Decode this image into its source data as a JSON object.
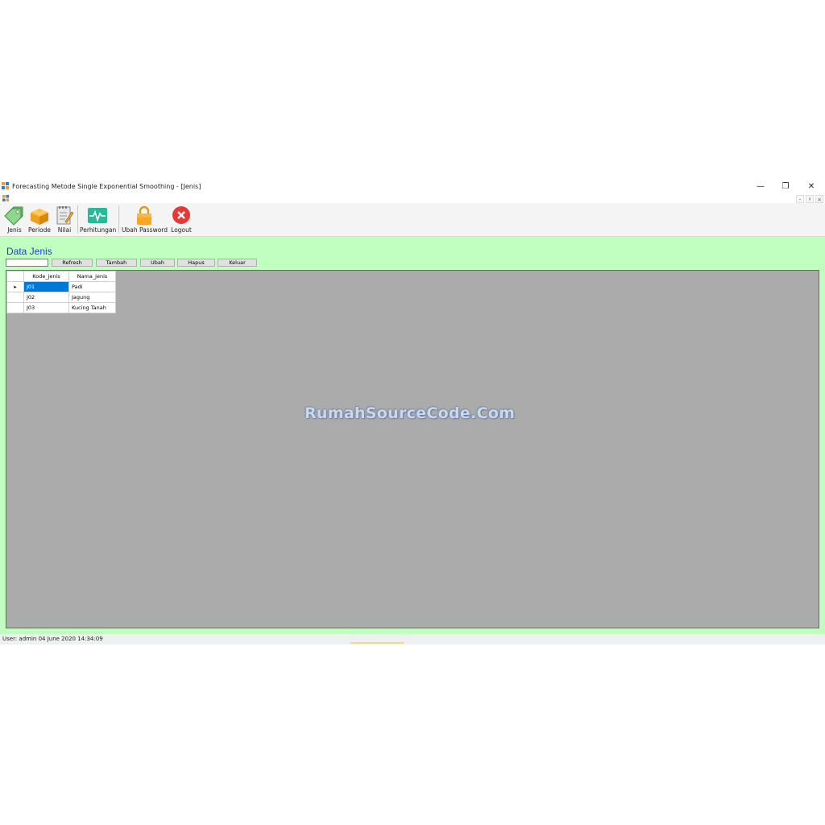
{
  "window": {
    "title": "Forecasting Metode Single Exponential Smoothing - [Jenis]",
    "minimize_glyph": "—",
    "restore_glyph": "❐",
    "close_glyph": "✕",
    "mdi_minimize_glyph": "-",
    "mdi_restore_glyph": "ᵍ",
    "mdi_close_glyph": "×"
  },
  "toolbar": {
    "items": [
      {
        "label": "Jenis",
        "icon": "tag-icon"
      },
      {
        "label": "Periode",
        "icon": "brick-icon"
      },
      {
        "label": "Nilai",
        "icon": "notepad-icon"
      },
      {
        "label": "Perhitungan",
        "icon": "pulse-chart-icon"
      },
      {
        "label": "Ubah Password",
        "icon": "lock-icon"
      },
      {
        "label": "Logout",
        "icon": "close-circle-icon"
      }
    ]
  },
  "form": {
    "heading": "Data Jenis",
    "search_value": "",
    "buttons": {
      "refresh": "Refresh",
      "tambah": "Tambah",
      "ubah": "Ubah",
      "hapus": "Hapus",
      "keluar": "Keluar"
    }
  },
  "table": {
    "columns": [
      "Kode_jenis",
      "Nama_jenis"
    ],
    "rows": [
      {
        "kode": "J01",
        "nama": "Padi"
      },
      {
        "kode": "J02",
        "nama": "Jagung"
      },
      {
        "kode": "J03",
        "nama": "Kucing Tanah"
      }
    ],
    "row_indicator": "▸"
  },
  "watermark": "RumahSourceCode.Com",
  "status": {
    "text": "User: admin  04 June 2020 14:34:09"
  },
  "colors": {
    "content_bg": "#c0ffc0",
    "grid_bg": "#ababab",
    "heading": "#1a3fd6",
    "selection": "#0078d7"
  }
}
